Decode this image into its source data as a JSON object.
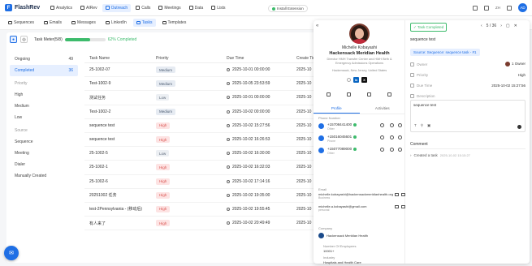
{
  "app": {
    "name": "FlashRev"
  },
  "nav": [
    {
      "label": "Analytics",
      "icon": "chart-icon",
      "active": false
    },
    {
      "label": "AIRev",
      "icon": "sparkle-icon",
      "active": false
    },
    {
      "label": "Outreach",
      "icon": "send-icon",
      "active": true
    },
    {
      "label": "Calls",
      "icon": "phone-icon",
      "active": false
    },
    {
      "label": "Meetings",
      "icon": "calendar-icon",
      "active": false
    },
    {
      "label": "Data",
      "icon": "database-icon",
      "active": false
    },
    {
      "label": "Lists",
      "icon": "list-icon",
      "active": false
    }
  ],
  "topbar": {
    "install_label": "Install Extension",
    "lang": "ZH",
    "user_initials": "AD"
  },
  "subtabs": [
    {
      "label": "Sequences",
      "active": false
    },
    {
      "label": "Emails",
      "active": false
    },
    {
      "label": "Messages",
      "active": false
    },
    {
      "label": "LinkedIn",
      "active": false
    },
    {
      "label": "Tasks",
      "active": true
    },
    {
      "label": "Templates",
      "active": false
    }
  ],
  "meter": {
    "label": "Task Meter(5/8)",
    "percent": 62,
    "percent_label": "62% Completed"
  },
  "sidebar": {
    "status": [
      {
        "label": "Ongoing",
        "count": "49",
        "active": false
      },
      {
        "label": "Completed",
        "count": "36",
        "active": true
      }
    ],
    "priority_title": "Priority",
    "priority": [
      "High",
      "Medium",
      "Low"
    ],
    "source_title": "Source",
    "source": [
      "Sequence",
      "Meeting",
      "Dialer",
      "Manually Created"
    ]
  },
  "table": {
    "headers": [
      "Task Name",
      "Priority",
      "Due Time",
      "Create Time"
    ],
    "rows": [
      {
        "name": "25-1002-07",
        "priority": "Medium",
        "due": "2025-10-01 00:00:00",
        "created": "2025-10"
      },
      {
        "name": "Test-1002-9",
        "priority": "Medium",
        "due": "2025-10-05 23:53:59",
        "created": "2025-10"
      },
      {
        "name": "测试任务",
        "priority": "Low",
        "due": "2025-10-01 00:00:00",
        "created": "2025-10"
      },
      {
        "name": "Test-1002-2",
        "priority": "Medium",
        "due": "2025-10-02 00:00:00",
        "created": "2025-10"
      },
      {
        "name": "sequence test",
        "priority": "High",
        "due": "2025-10-02 15:27:56",
        "created": "2025-10"
      },
      {
        "name": "sequence test",
        "priority": "High",
        "due": "2025-10-02 16:26:53",
        "created": "2025-10"
      },
      {
        "name": "25-1002-5",
        "priority": "Low",
        "due": "2025-10-02 16:30:00",
        "created": "2025-10"
      },
      {
        "name": "25-1002-1",
        "priority": "High",
        "due": "2025-10-02 16:32:03",
        "created": "2025-10"
      },
      {
        "name": "25-1002-6",
        "priority": "High",
        "due": "2025-10-02 17:14:16",
        "created": "2025-10"
      },
      {
        "name": "20251002 任务",
        "priority": "High",
        "due": "2025-10-02 19:35:00",
        "created": "2025-10"
      },
      {
        "name": "test-2Pennsylvania - (移动后)",
        "priority": "High",
        "due": "2025-10-02 19:55:45",
        "created": "2025-10"
      },
      {
        "name": "有人来了",
        "priority": "High",
        "due": "2025-10-02 20:49:49",
        "created": "2025-10"
      }
    ]
  },
  "contact": {
    "name": "Michelle Kobayashi",
    "company": "Hackensack Meridian Health",
    "title": "Director HMH Transfer Center and HMH Birth & Emergency Admissions Operations",
    "location": "Hackensack, New Jersey, United States",
    "tabs": [
      "Profile",
      "Activities"
    ],
    "phone_title": "Phone Number",
    "phones": [
      {
        "number": "+15708441400",
        "type": "Other"
      },
      {
        "number": "+15016045601",
        "type": "Phone"
      },
      {
        "number": "+15077089000",
        "type": "Other"
      }
    ],
    "email_title": "Email",
    "emails": [
      {
        "addr": "michelle.kobayashi@hackensackmeridianhealth.org",
        "type": "Business"
      },
      {
        "addr": "michelle.a.kobayashi@gmail.com",
        "type": "personal"
      }
    ],
    "company_title": "Company",
    "company_name": "Hackensack Meridian Health",
    "employees_title": "Number Of Employees",
    "employees": "10001+",
    "industry_title": "Industry",
    "industry": "Hospitals and Health Care"
  },
  "task": {
    "status_btn": "Task Completed",
    "pager": "5 / 36",
    "title": "sequence test",
    "source_badge": "Source: Sequence: sequence task - #1",
    "props": [
      {
        "key": "Owner",
        "value": "1 Owner"
      },
      {
        "key": "Priority",
        "value": "High"
      },
      {
        "key": "Due Time",
        "value": "2025-10-02 15:27:56"
      },
      {
        "key": "Description",
        "value": ""
      }
    ],
    "note": "sequence test",
    "comment_title": "Comment",
    "comment_action": "Created a task",
    "comment_time": "2025-10-02 15:15:27"
  }
}
